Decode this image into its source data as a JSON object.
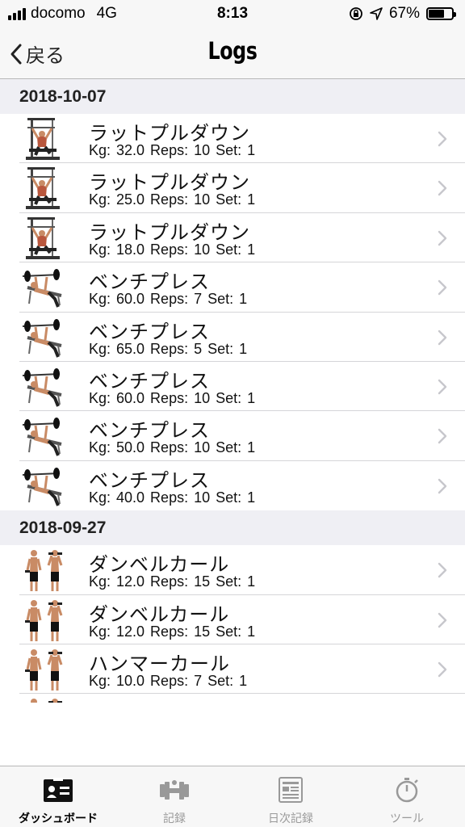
{
  "status": {
    "carrier": "docomo",
    "network": "4G",
    "time": "8:13",
    "battery_label": "67%",
    "battery_fraction": 0.67
  },
  "nav": {
    "back_label": "戻る",
    "title": "Logs"
  },
  "sections": [
    {
      "date": "2018-10-07",
      "rows": [
        {
          "icon": "lat-pulldown",
          "name": "ラットプルダウン",
          "detail": "Kg: 32.0  Reps: 10  Set: 1"
        },
        {
          "icon": "lat-pulldown",
          "name": "ラットプルダウン",
          "detail": "Kg: 25.0  Reps: 10  Set: 1"
        },
        {
          "icon": "lat-pulldown",
          "name": "ラットプルダウン",
          "detail": "Kg: 18.0  Reps: 10  Set: 1"
        },
        {
          "icon": "bench-press",
          "name": "ベンチプレス",
          "detail": "Kg: 60.0  Reps: 7  Set: 1"
        },
        {
          "icon": "bench-press",
          "name": "ベンチプレス",
          "detail": "Kg: 65.0  Reps: 5  Set: 1"
        },
        {
          "icon": "bench-press",
          "name": "ベンチプレス",
          "detail": "Kg: 60.0  Reps: 10  Set: 1"
        },
        {
          "icon": "bench-press",
          "name": "ベンチプレス",
          "detail": "Kg: 50.0  Reps: 10  Set: 1"
        },
        {
          "icon": "bench-press",
          "name": "ベンチプレス",
          "detail": "Kg: 40.0  Reps: 10  Set: 1"
        }
      ]
    },
    {
      "date": "2018-09-27",
      "rows": [
        {
          "icon": "dumbbell-curl",
          "name": "ダンベルカール",
          "detail": "Kg: 12.0  Reps: 15  Set: 1"
        },
        {
          "icon": "dumbbell-curl",
          "name": "ダンベルカール",
          "detail": "Kg: 12.0  Reps: 15  Set: 1"
        },
        {
          "icon": "hammer-curl",
          "name": "ハンマーカール",
          "detail": "Kg: 10.0  Reps: 7  Set: 1"
        },
        {
          "icon": "hammer-curl",
          "name": "",
          "detail": ""
        }
      ]
    }
  ],
  "tabs": [
    {
      "label": "ダッシュボード",
      "icon": "dashboard-card-icon",
      "active": true
    },
    {
      "label": "記録",
      "icon": "dumbbell-icon",
      "active": false
    },
    {
      "label": "日次記録",
      "icon": "daily-log-icon",
      "active": false
    },
    {
      "label": "ツール",
      "icon": "stopwatch-icon",
      "active": false
    }
  ],
  "colors": {
    "bar_background": "#f7f7f7",
    "section_background": "#efeff4",
    "chevron": "#c7c7cc",
    "inactive_tab": "#999999"
  }
}
